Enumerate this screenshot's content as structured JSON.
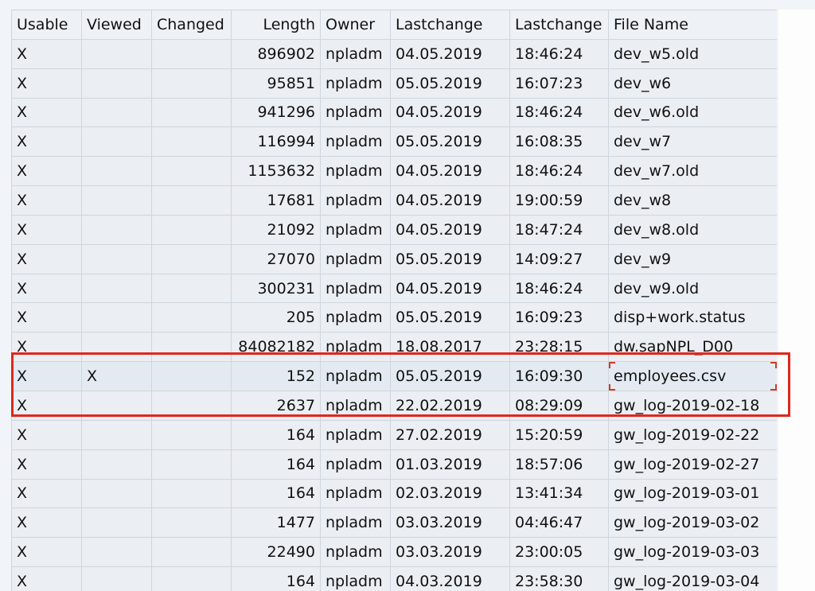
{
  "columns": [
    "Usable",
    "Viewed",
    "Changed",
    "Length",
    "Owner",
    "Lastchange",
    "Lastchange",
    "File Name"
  ],
  "rows": [
    {
      "usable": "X",
      "viewed": "",
      "changed": "",
      "length": "896902",
      "owner": "npladm",
      "date": "04.05.2019",
      "time": "18:46:24",
      "file": "dev_w5.old"
    },
    {
      "usable": "X",
      "viewed": "",
      "changed": "",
      "length": "95851",
      "owner": "npladm",
      "date": "05.05.2019",
      "time": "16:07:23",
      "file": "dev_w6"
    },
    {
      "usable": "X",
      "viewed": "",
      "changed": "",
      "length": "941296",
      "owner": "npladm",
      "date": "04.05.2019",
      "time": "18:46:24",
      "file": "dev_w6.old"
    },
    {
      "usable": "X",
      "viewed": "",
      "changed": "",
      "length": "116994",
      "owner": "npladm",
      "date": "05.05.2019",
      "time": "16:08:35",
      "file": "dev_w7"
    },
    {
      "usable": "X",
      "viewed": "",
      "changed": "",
      "length": "1153632",
      "owner": "npladm",
      "date": "04.05.2019",
      "time": "18:46:24",
      "file": "dev_w7.old"
    },
    {
      "usable": "X",
      "viewed": "",
      "changed": "",
      "length": "17681",
      "owner": "npladm",
      "date": "04.05.2019",
      "time": "19:00:59",
      "file": "dev_w8"
    },
    {
      "usable": "X",
      "viewed": "",
      "changed": "",
      "length": "21092",
      "owner": "npladm",
      "date": "04.05.2019",
      "time": "18:47:24",
      "file": "dev_w8.old"
    },
    {
      "usable": "X",
      "viewed": "",
      "changed": "",
      "length": "27070",
      "owner": "npladm",
      "date": "05.05.2019",
      "time": "14:09:27",
      "file": "dev_w9"
    },
    {
      "usable": "X",
      "viewed": "",
      "changed": "",
      "length": "300231",
      "owner": "npladm",
      "date": "04.05.2019",
      "time": "18:46:24",
      "file": "dev_w9.old"
    },
    {
      "usable": "X",
      "viewed": "",
      "changed": "",
      "length": "205",
      "owner": "npladm",
      "date": "05.05.2019",
      "time": "16:09:23",
      "file": "disp+work.status"
    },
    {
      "usable": "X",
      "viewed": "",
      "changed": "",
      "length": "84082182",
      "owner": "npladm",
      "date": "18.08.2017",
      "time": "23:28:15",
      "file": "dw.sapNPL_D00"
    },
    {
      "usable": "X",
      "viewed": "X",
      "changed": "",
      "length": "152",
      "owner": "npladm",
      "date": "05.05.2019",
      "time": "16:09:30",
      "file": "employees.csv",
      "selected": true
    },
    {
      "usable": "X",
      "viewed": "",
      "changed": "",
      "length": "2637",
      "owner": "npladm",
      "date": "22.02.2019",
      "time": "08:29:09",
      "file": "gw_log-2019-02-18"
    },
    {
      "usable": "X",
      "viewed": "",
      "changed": "",
      "length": "164",
      "owner": "npladm",
      "date": "27.02.2019",
      "time": "15:20:59",
      "file": "gw_log-2019-02-22"
    },
    {
      "usable": "X",
      "viewed": "",
      "changed": "",
      "length": "164",
      "owner": "npladm",
      "date": "01.03.2019",
      "time": "18:57:06",
      "file": "gw_log-2019-02-27"
    },
    {
      "usable": "X",
      "viewed": "",
      "changed": "",
      "length": "164",
      "owner": "npladm",
      "date": "02.03.2019",
      "time": "13:41:34",
      "file": "gw_log-2019-03-01"
    },
    {
      "usable": "X",
      "viewed": "",
      "changed": "",
      "length": "1477",
      "owner": "npladm",
      "date": "03.03.2019",
      "time": "04:46:47",
      "file": "gw_log-2019-03-02"
    },
    {
      "usable": "X",
      "viewed": "",
      "changed": "",
      "length": "22490",
      "owner": "npladm",
      "date": "03.03.2019",
      "time": "23:00:05",
      "file": "gw_log-2019-03-03"
    },
    {
      "usable": "X",
      "viewed": "",
      "changed": "",
      "length": "164",
      "owner": "npladm",
      "date": "04.03.2019",
      "time": "23:58:30",
      "file": "gw_log-2019-03-04"
    }
  ],
  "colors": {
    "highlight": "#e0271c",
    "focus_cell": "#e4f1fb"
  }
}
